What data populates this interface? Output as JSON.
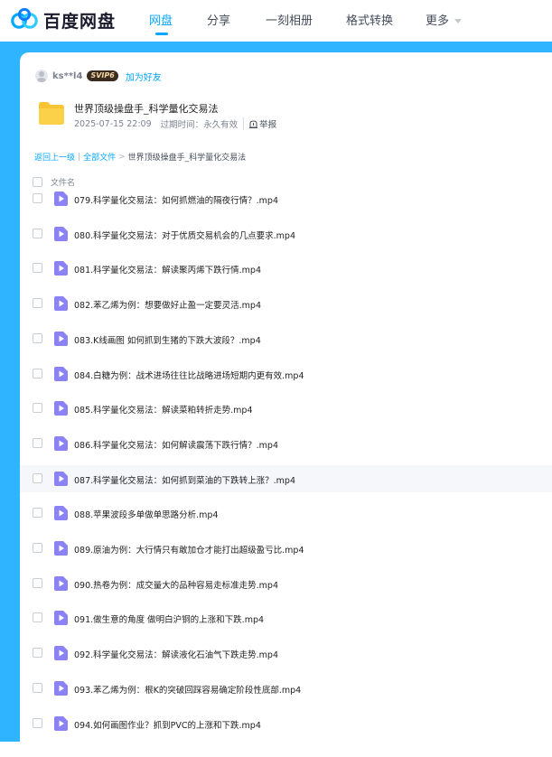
{
  "header": {
    "logo_text": "百度网盘",
    "nav": [
      {
        "label": "网盘",
        "active": true
      },
      {
        "label": "分享",
        "active": false
      },
      {
        "label": "一刻相册",
        "active": false
      },
      {
        "label": "格式转换",
        "active": false
      },
      {
        "label": "更多",
        "active": false
      }
    ]
  },
  "sharer": {
    "name": "ks**l4",
    "badge": "SVIP6",
    "add_friend": "加为好友"
  },
  "share": {
    "title": "世界顶级操盘手_科学量化交易法",
    "date": "2025-07-15 22:09",
    "expire_label": "过期时间：永久有效",
    "report": "举报"
  },
  "breadcrumb": {
    "back": "返回上一级",
    "sep": "|",
    "all_files": "全部文件",
    "arrow": ">",
    "current": "世界顶级操盘手_科学量化交易法"
  },
  "list": {
    "column_name": "文件名",
    "files": [
      "079.科学量化交易法：如何抓燃油的隔夜行情？.mp4",
      "080.科学量化交易法：对于优质交易机会的几点要求.mp4",
      "081.科学量化交易法：解读聚丙烯下跌行情.mp4",
      "082.苯乙烯为例：想要做好止盈一定要灵活.mp4",
      "083.K线画图 如何抓到生猪的下跌大波段？.mp4",
      "084.白糖为例：战术进场往往比战略进场短期内更有效.mp4",
      "085.科学量化交易法：解读菜粕转折走势.mp4",
      "086.科学量化交易法：如何解读震荡下跌行情？.mp4",
      "087.科学量化交易法：如何抓到菜油的下跌转上涨？.mp4",
      "088.苹果波段多单做单思路分析.mp4",
      "089.原油为例：大行情只有敢加仓才能打出超级盈亏比.mp4",
      "090.热卷为例：成交量大的品种容易走标准走势.mp4",
      "091.做生意的角度 做明白沪铜的上涨和下跌.mp4",
      "092.科学量化交易法：解读液化石油气下跌走势.mp4",
      "093.苯乙烯为例：根K的突破回踩容易确定阶段性底部.mp4",
      "094.如何画图作业？抓到PVC的上涨和下跌.mp4"
    ],
    "hover_index": 8
  },
  "colors": {
    "accent": "#06a7ff",
    "frame": "#2fb4ff",
    "folder": "#f9c431",
    "video_icon": "#8b82f6"
  }
}
